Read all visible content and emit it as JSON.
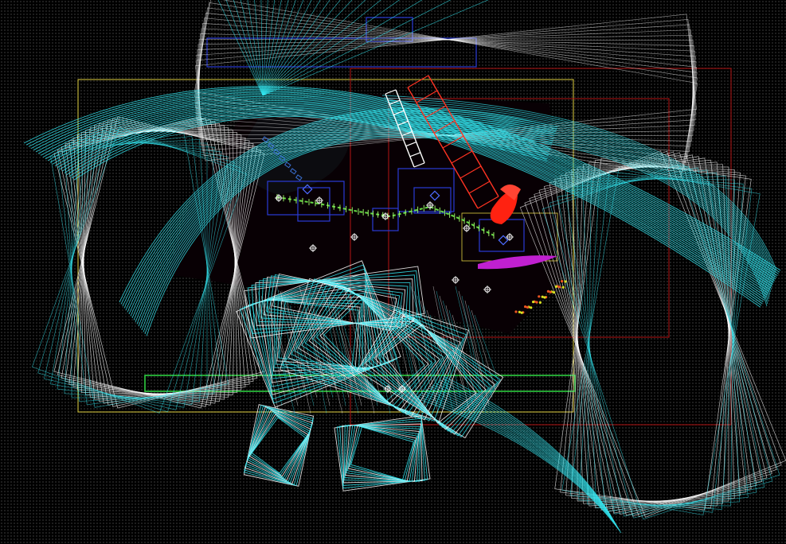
{
  "scene": {
    "title": "",
    "view": "debug-wireframe",
    "colors": {
      "background": "#000000",
      "grid_dot": "#3a3a3a",
      "wireframe_primary": "#33e6f0",
      "wireframe_secondary": "#ffffff",
      "bounds_red": "#b41414",
      "bounds_blue": "#2a3bd6",
      "bounds_green": "#2ecc40",
      "bounds_yellow": "#e0d040",
      "rail_red": "#ff3322",
      "particle_red": "#ff2211",
      "particle_magenta": "#c020d0",
      "particle_yellow": "#d8e020",
      "path_green": "#66dd44"
    },
    "icons": [
      "crosshair-marker-icon",
      "bone-joint-icon",
      "spawn-point-icon"
    ]
  }
}
